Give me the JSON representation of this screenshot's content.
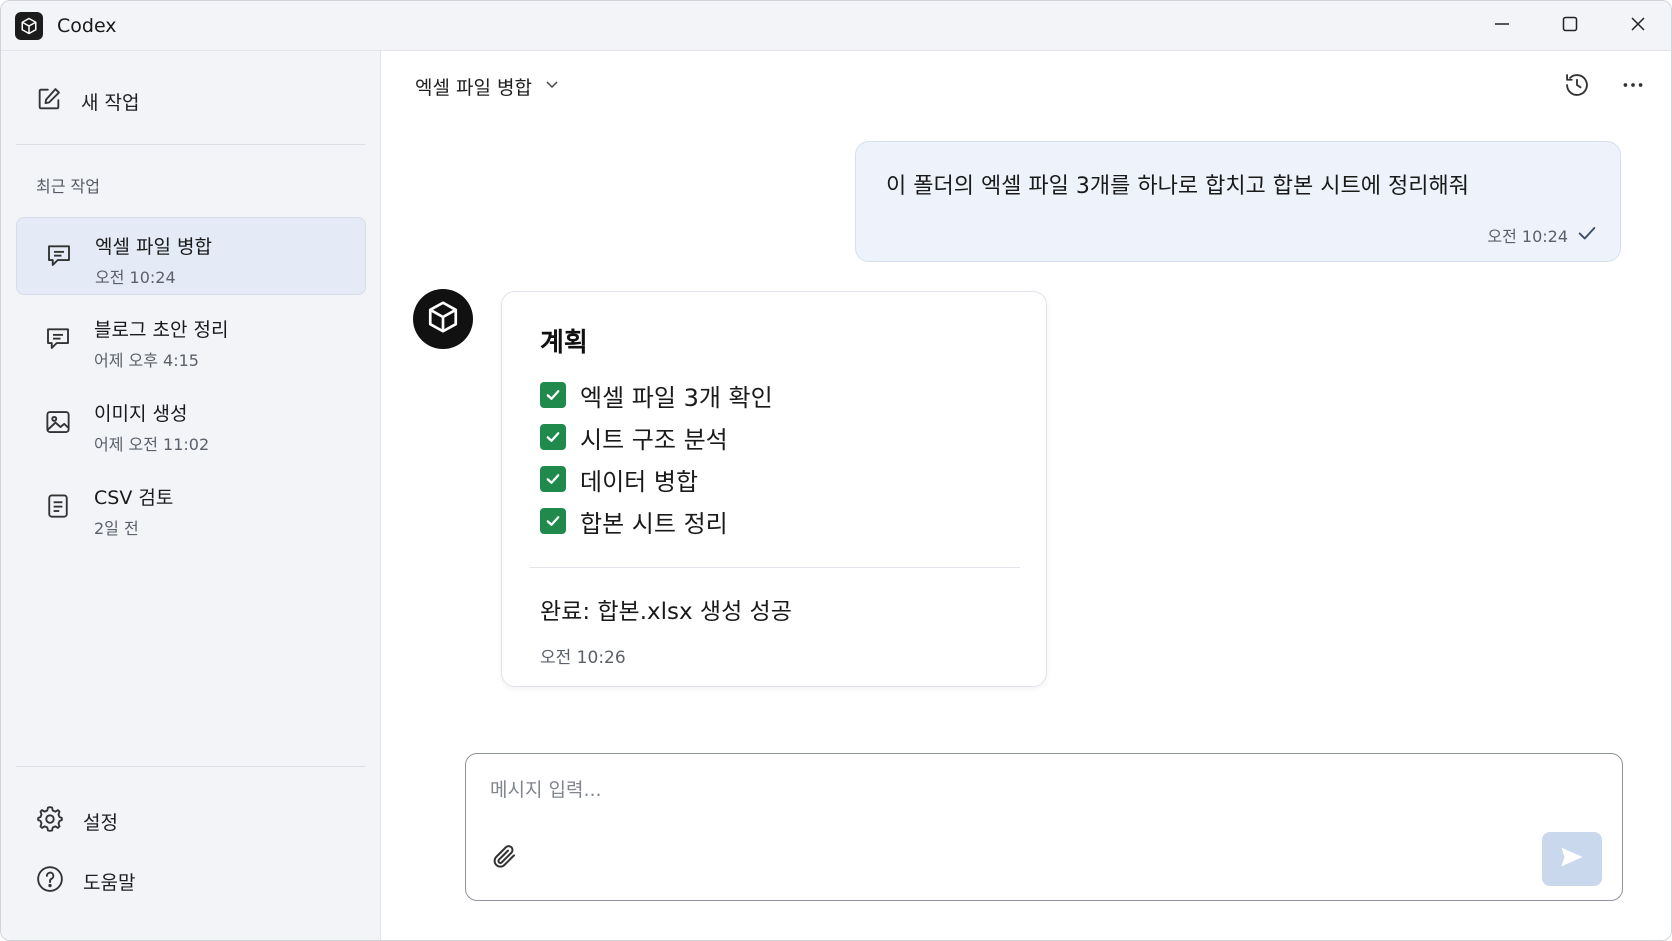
{
  "app": {
    "title": "Codex",
    "logo_icon": "codex-cube-icon"
  },
  "window_controls": {
    "minimize_icon": "minimize-icon",
    "maximize_icon": "maximize-icon",
    "close_icon": "close-icon"
  },
  "sidebar": {
    "new_task_label": "새 작업",
    "new_task_icon": "edit-icon",
    "recent_label": "최근 작업",
    "tasks": [
      {
        "title": "엑셀 파일 병합",
        "time": "오전 10:24",
        "icon": "chat-icon",
        "active": true
      },
      {
        "title": "블로그 초안 정리",
        "time": "어제 오후 4:15",
        "icon": "chat-icon",
        "active": false
      },
      {
        "title": "이미지 생성",
        "time": "어제 오전 11:02",
        "icon": "image-icon",
        "active": false
      },
      {
        "title": "CSV 검토",
        "time": "2일 전",
        "icon": "document-icon",
        "active": false
      }
    ],
    "settings_label": "설정",
    "settings_icon": "gear-icon",
    "help_label": "도움말",
    "help_icon": "help-icon"
  },
  "header": {
    "conversation_title": "엑셀 파일 병합",
    "history_icon": "history-icon",
    "more_icon": "more-icon"
  },
  "messages": {
    "user": {
      "text": "이 폴더의 엑셀 파일 3개를 하나로 합치고 합본 시트에 정리해줘",
      "time": "오전 10:24",
      "status_icon": "check-icon"
    },
    "assistant": {
      "plan_title": "계획",
      "plan_items": [
        {
          "label": "엑셀 파일 3개 확인",
          "checked": true
        },
        {
          "label": "시트 구조 분석",
          "checked": true
        },
        {
          "label": "데이터 병합",
          "checked": true
        },
        {
          "label": "합본 시트 정리",
          "checked": true
        }
      ],
      "result": "완료: 합본.xlsx 생성 성공",
      "time": "오전 10:26"
    }
  },
  "composer": {
    "placeholder": "메시지 입력...",
    "value": "",
    "attach_icon": "paperclip-icon",
    "send_icon": "send-icon"
  },
  "colors": {
    "accent_check": "#1f8a4c",
    "user_bubble": "#edf2fb",
    "sidebar_bg": "#f2f4f8",
    "send_button": "#c9d8ec"
  }
}
